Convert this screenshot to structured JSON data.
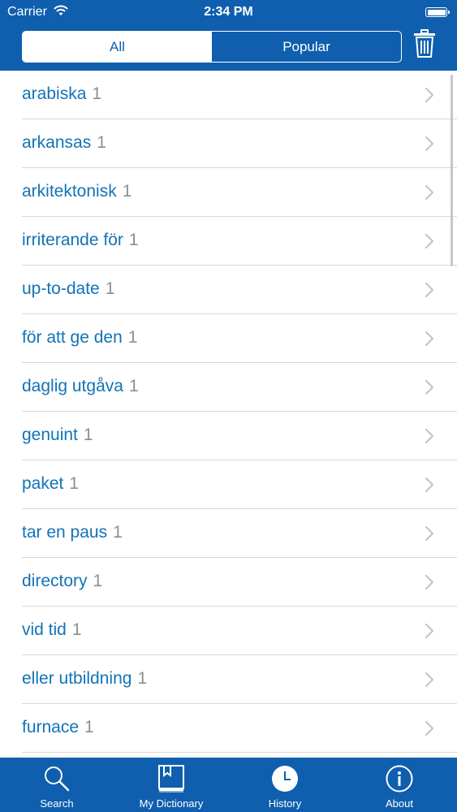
{
  "status": {
    "carrier": "Carrier",
    "time": "2:34 PM"
  },
  "segments": {
    "all": "All",
    "popular": "Popular",
    "selected": "All"
  },
  "items": [
    {
      "term": "arabiska",
      "count": "1"
    },
    {
      "term": "arkansas",
      "count": "1"
    },
    {
      "term": "arkitektonisk",
      "count": "1"
    },
    {
      "term": "irriterande för",
      "count": "1"
    },
    {
      "term": "up-to-date",
      "count": "1"
    },
    {
      "term": "för att ge den",
      "count": "1"
    },
    {
      "term": "daglig utgåva",
      "count": "1"
    },
    {
      "term": "genuint",
      "count": "1"
    },
    {
      "term": "paket",
      "count": "1"
    },
    {
      "term": "tar en paus",
      "count": "1"
    },
    {
      "term": "directory",
      "count": "1"
    },
    {
      "term": "vid tid",
      "count": "1"
    },
    {
      "term": "eller utbildning",
      "count": "1"
    },
    {
      "term": "furnace",
      "count": "1"
    }
  ],
  "tabs": [
    {
      "label": "Search",
      "icon": "search-icon"
    },
    {
      "label": "My Dictionary",
      "icon": "book-icon"
    },
    {
      "label": "History",
      "icon": "clock-icon",
      "selected": true
    },
    {
      "label": "About",
      "icon": "info-icon"
    }
  ],
  "colors": {
    "brand": "#0f5fae",
    "link": "#1273b7",
    "count": "#8e8e8e"
  }
}
